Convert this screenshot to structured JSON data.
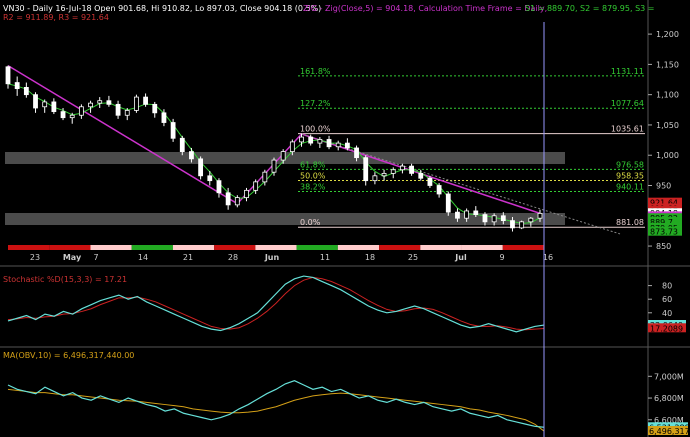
{
  "header": {
    "l1_a": "VN30 - Daily 16-Jul-18 Open 901.68, Hi 910.82, Lo 897.03, Close 904.18 (0.5%)",
    "l1_b": "ZIG - Zig(Close,5) = 904.18, Calculation Time Frame = Daily,",
    "l1_c": "S1 = 889.70, S2 = 879.95, S3 =",
    "l2": "R2 = 911.89, R3 = 921.64"
  },
  "colors": {
    "up": "#ffffff",
    "down": "#ffffff",
    "zig": "#cc33cc",
    "fib": "#33cc33",
    "trend": "#33cc33",
    "stochK": "#66e0d8",
    "stochD": "#cc2222",
    "obv": "#66e0d8",
    "obvMA": "#d4a017",
    "cursor": "#9999ff"
  },
  "fib_levels": [
    {
      "pct": "161.8%",
      "val": "1131.11",
      "v": 1131.11
    },
    {
      "pct": "127.2%",
      "val": "1077.64",
      "v": 1077.64
    },
    {
      "pct": "100.0%",
      "val": "1035.61",
      "v": 1035.61
    },
    {
      "pct": "61.8%",
      "val": "976.58",
      "v": 976.58
    },
    {
      "pct": "50.0%",
      "val": "958.35",
      "v": 958.35
    },
    {
      "pct": "38.2%",
      "val": "940.11",
      "v": 940.11
    },
    {
      "pct": "0.0%",
      "val": "881.08",
      "v": 881.08
    }
  ],
  "price_axis": {
    "ticks": [
      "1,200",
      "1,150",
      "1,100",
      "1,050",
      "1,000",
      "950",
      "850"
    ],
    "tick_values": [
      1200,
      1150,
      1100,
      1050,
      1000,
      950,
      850
    ]
  },
  "price_labels": [
    {
      "text": "921.64",
      "v": 921.64,
      "bg": "#cc2222"
    },
    {
      "text": "911.89",
      "v": 911.89,
      "bg": "#cc2222"
    },
    {
      "text": "908.07",
      "v": 908.07,
      "bg": "#cc2222"
    },
    {
      "text": "904.18",
      "v": 904.18,
      "bg": "#ffffff"
    },
    {
      "text": "904.18",
      "v": 899.0,
      "bg": "#cc33cc"
    },
    {
      "text": "895.92",
      "v": 895.92,
      "bg": "#22aa22"
    },
    {
      "text": "889.7",
      "v": 889.7,
      "bg": "#22aa22"
    },
    {
      "text": "879.95",
      "v": 879.95,
      "bg": "#22aa22"
    },
    {
      "text": "873.73",
      "v": 873.73,
      "bg": "#22aa22"
    }
  ],
  "date_axis": {
    "labels": [
      "23",
      "May",
      "7",
      "14",
      "21",
      "28",
      "Jun",
      "11",
      "18",
      "25",
      "Jul",
      "9",
      "16"
    ]
  },
  "stoch": {
    "title": "Stochastic %D(15,3,3) = 17.21",
    "ticks": [
      "80",
      "60",
      "40"
    ],
    "tick_values": [
      80,
      60,
      40
    ],
    "labels": [
      {
        "text": "22.0649",
        "v": 22.06,
        "bg": "#66e0d8"
      },
      {
        "text": "17.2089",
        "v": 17.21,
        "bg": "#cc2222"
      }
    ]
  },
  "obv": {
    "title": "MA(OBV,10) = 6,496,317,440.00",
    "ticks": [
      "7,000M",
      "6,800M",
      "6,600M"
    ],
    "tick_values": [
      7000,
      6800,
      6600
    ],
    "labels": [
      {
        "text": "6,531,288",
        "v": 6531,
        "bg": "#66e0d8"
      },
      {
        "text": "6,496,317",
        "v": 6496,
        "bg": "#d4a017"
      }
    ]
  },
  "chart_data": {
    "type": "candlestick",
    "title": "VN30 - Daily",
    "ohlc": [
      [
        1146,
        1148,
        1110,
        1118
      ],
      [
        1120,
        1130,
        1098,
        1110
      ],
      [
        1112,
        1120,
        1095,
        1100
      ],
      [
        1100,
        1104,
        1070,
        1078
      ],
      [
        1080,
        1092,
        1070,
        1088
      ],
      [
        1088,
        1094,
        1068,
        1072
      ],
      [
        1072,
        1078,
        1058,
        1062
      ],
      [
        1062,
        1070,
        1052,
        1066
      ],
      [
        1066,
        1084,
        1060,
        1080
      ],
      [
        1080,
        1090,
        1070,
        1086
      ],
      [
        1086,
        1096,
        1078,
        1090
      ],
      [
        1090,
        1098,
        1080,
        1084
      ],
      [
        1084,
        1090,
        1060,
        1066
      ],
      [
        1066,
        1078,
        1058,
        1074
      ],
      [
        1074,
        1100,
        1070,
        1096
      ],
      [
        1096,
        1102,
        1080,
        1084
      ],
      [
        1084,
        1088,
        1062,
        1070
      ],
      [
        1070,
        1076,
        1048,
        1054
      ],
      [
        1054,
        1060,
        1022,
        1028
      ],
      [
        1028,
        1032,
        1000,
        1006
      ],
      [
        1006,
        1012,
        988,
        994
      ],
      [
        994,
        998,
        960,
        966
      ],
      [
        966,
        974,
        950,
        958
      ],
      [
        958,
        962,
        930,
        938
      ],
      [
        938,
        946,
        910,
        918
      ],
      [
        918,
        934,
        914,
        930
      ],
      [
        930,
        946,
        924,
        942
      ],
      [
        942,
        960,
        936,
        956
      ],
      [
        956,
        976,
        950,
        972
      ],
      [
        972,
        996,
        966,
        992
      ],
      [
        992,
        1010,
        986,
        1006
      ],
      [
        1006,
        1026,
        1000,
        1022
      ],
      [
        1022,
        1036,
        1014,
        1030
      ],
      [
        1030,
        1034,
        1016,
        1020
      ],
      [
        1020,
        1030,
        1012,
        1026
      ],
      [
        1026,
        1032,
        1010,
        1014
      ],
      [
        1014,
        1024,
        1008,
        1020
      ],
      [
        1020,
        1028,
        1008,
        1012
      ],
      [
        1012,
        1016,
        990,
        996
      ],
      [
        996,
        1000,
        950,
        958
      ],
      [
        958,
        972,
        952,
        966
      ],
      [
        966,
        976,
        958,
        970
      ],
      [
        970,
        980,
        962,
        976
      ],
      [
        976,
        986,
        970,
        982
      ],
      [
        982,
        986,
        966,
        970
      ],
      [
        970,
        976,
        958,
        962
      ],
      [
        962,
        966,
        946,
        950
      ],
      [
        950,
        954,
        930,
        936
      ],
      [
        936,
        940,
        900,
        906
      ],
      [
        906,
        912,
        890,
        896
      ],
      [
        896,
        912,
        890,
        908
      ],
      [
        908,
        916,
        898,
        902
      ],
      [
        902,
        906,
        884,
        890
      ],
      [
        890,
        904,
        884,
        900
      ],
      [
        900,
        906,
        886,
        892
      ],
      [
        892,
        898,
        874,
        880
      ],
      [
        880,
        892,
        878,
        890
      ],
      [
        890,
        898,
        882,
        896
      ],
      [
        896,
        910,
        890,
        904
      ]
    ],
    "zigzag": [
      [
        0,
        1148
      ],
      [
        25,
        920
      ],
      [
        32,
        1035
      ],
      [
        58,
        904
      ]
    ],
    "fibs": [
      1131.11,
      1077.64,
      1035.61,
      976.58,
      958.35,
      940.11,
      881.08
    ],
    "stoch_k": [
      28,
      32,
      36,
      30,
      38,
      35,
      42,
      38,
      46,
      52,
      58,
      62,
      66,
      60,
      64,
      56,
      50,
      44,
      38,
      32,
      26,
      20,
      16,
      14,
      18,
      24,
      32,
      40,
      54,
      68,
      82,
      90,
      94,
      92,
      86,
      80,
      74,
      66,
      58,
      50,
      44,
      40,
      42,
      46,
      50,
      46,
      40,
      34,
      28,
      22,
      18,
      20,
      24,
      20,
      16,
      12,
      16,
      20,
      22
    ],
    "stoch_d": [
      30,
      31,
      33,
      32,
      34,
      35,
      38,
      39,
      42,
      46,
      52,
      57,
      62,
      62,
      63,
      60,
      56,
      50,
      44,
      38,
      32,
      26,
      20,
      17,
      16,
      18,
      24,
      32,
      42,
      54,
      68,
      80,
      88,
      92,
      90,
      86,
      80,
      74,
      66,
      58,
      51,
      45,
      42,
      43,
      46,
      47,
      45,
      40,
      34,
      28,
      23,
      20,
      20,
      21,
      19,
      16,
      15,
      16,
      17
    ],
    "obv": [
      6920,
      6880,
      6860,
      6840,
      6900,
      6860,
      6820,
      6850,
      6800,
      6780,
      6820,
      6790,
      6760,
      6800,
      6770,
      6740,
      6720,
      6680,
      6700,
      6660,
      6640,
      6620,
      6600,
      6620,
      6650,
      6700,
      6740,
      6790,
      6840,
      6880,
      6930,
      6960,
      6920,
      6880,
      6900,
      6860,
      6880,
      6840,
      6800,
      6820,
      6780,
      6760,
      6790,
      6760,
      6740,
      6760,
      6720,
      6700,
      6680,
      6700,
      6660,
      6640,
      6620,
      6640,
      6600,
      6580,
      6560,
      6540,
      6531
    ],
    "obv_ma": [
      6880,
      6870,
      6860,
      6850,
      6850,
      6840,
      6830,
      6830,
      6820,
      6810,
      6800,
      6790,
      6780,
      6775,
      6770,
      6760,
      6750,
      6740,
      6730,
      6720,
      6700,
      6690,
      6680,
      6670,
      6665,
      6665,
      6670,
      6680,
      6700,
      6720,
      6750,
      6780,
      6800,
      6820,
      6830,
      6840,
      6845,
      6840,
      6830,
      6820,
      6810,
      6800,
      6790,
      6780,
      6770,
      6760,
      6750,
      6740,
      6730,
      6720,
      6700,
      6690,
      6670,
      6655,
      6640,
      6620,
      6600,
      6560,
      6496
    ],
    "price_range": [
      860,
      1220
    ],
    "stoch_range": [
      0,
      100
    ],
    "obv_range": [
      6460,
      7150
    ]
  }
}
